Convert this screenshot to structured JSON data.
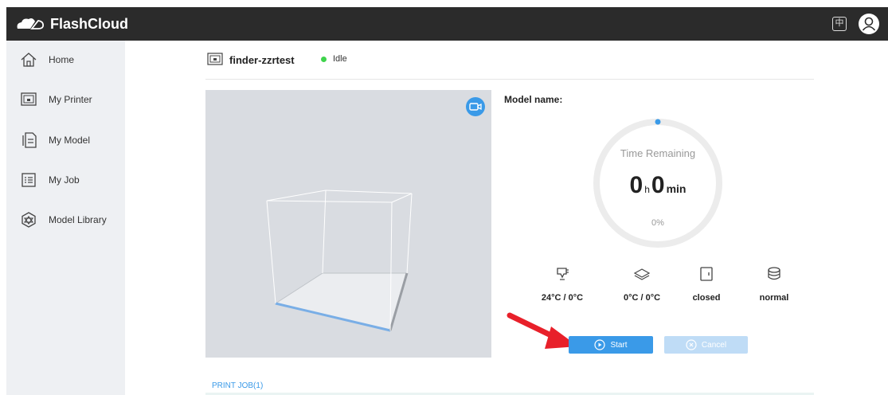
{
  "app": {
    "title": "FlashCloud"
  },
  "topbar": {
    "lang_label": "中"
  },
  "sidebar": {
    "items": [
      {
        "label": "Home",
        "icon": "home-icon"
      },
      {
        "label": "My Printer",
        "icon": "printer-icon"
      },
      {
        "label": "My Model",
        "icon": "model-icon"
      },
      {
        "label": "My Job",
        "icon": "job-icon"
      },
      {
        "label": "Model Library",
        "icon": "library-icon"
      }
    ]
  },
  "header": {
    "printer_name": "finder-zzrtest",
    "status": "Idle",
    "status_color": "#3fd34c"
  },
  "info": {
    "model_name_label": "Model name:",
    "time_label": "Time Remaining",
    "hours": "0",
    "hours_unit": "h",
    "minutes": "0",
    "minutes_unit": "min",
    "progress_text": "0%",
    "progress": 0
  },
  "stats": [
    {
      "icon": "nozzle-icon",
      "value": "24°C / 0°C"
    },
    {
      "icon": "bed-icon",
      "value": "0°C / 0°C"
    },
    {
      "icon": "door-icon",
      "value": "closed"
    },
    {
      "icon": "fan-icon",
      "value": "normal"
    }
  ],
  "actions": {
    "start_label": "Start",
    "cancel_label": "Cancel"
  },
  "print_job": {
    "label": "PRINT JOB(1)"
  },
  "colors": {
    "accent": "#3a9ae8",
    "topbar": "#2b2b2b",
    "sidebar": "#eef0f3"
  }
}
